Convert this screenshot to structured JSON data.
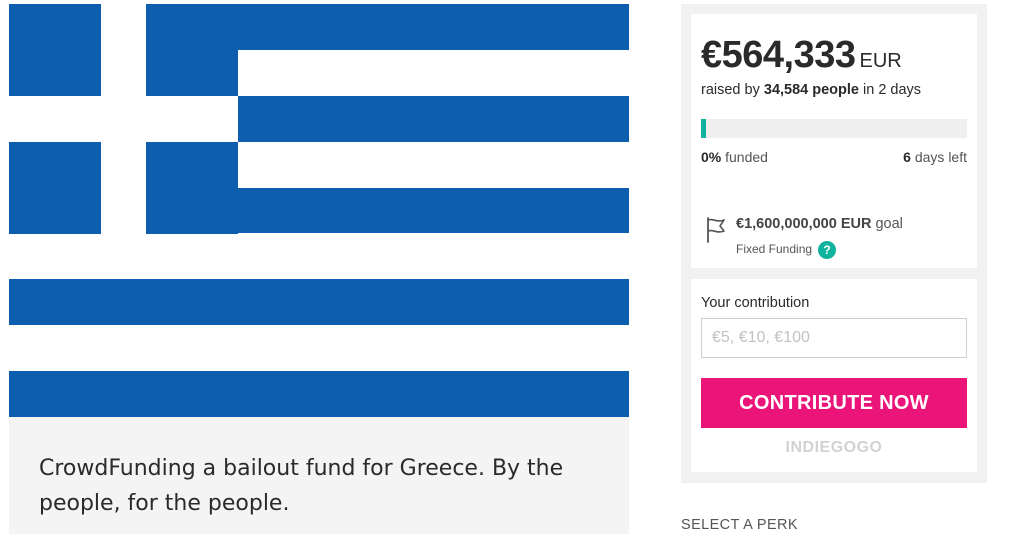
{
  "campaign": {
    "description": "CrowdFunding a bailout fund for Greece. By the people, for the people."
  },
  "funding": {
    "amount": "€564,333",
    "currency": "EUR",
    "raised_by_prefix": "raised by",
    "people_count": "34,584 people",
    "duration": "in 2 days",
    "progress_fraction": 0.02,
    "progress_color": "#0fb39e",
    "funded_percent": "0%",
    "funded_label": "funded",
    "days_left_value": "6",
    "days_left_label": "days left",
    "goal_amount": "€1,600,000,000 EUR",
    "goal_label": "goal",
    "funding_type": "Fixed Funding",
    "help_icon": "?",
    "flag_icon": "goal-flag-icon"
  },
  "contribute": {
    "label": "Your contribution",
    "placeholder": "€5, €10, €100",
    "button_label": "CONTRIBUTE NOW",
    "button_color": "#eb1478",
    "brand": "INDIEGOGO"
  },
  "perks": {
    "heading": "SELECT A PERK"
  },
  "colors": {
    "flag_blue": "#0d5eaf",
    "panel_background": "#f1f1f1"
  }
}
